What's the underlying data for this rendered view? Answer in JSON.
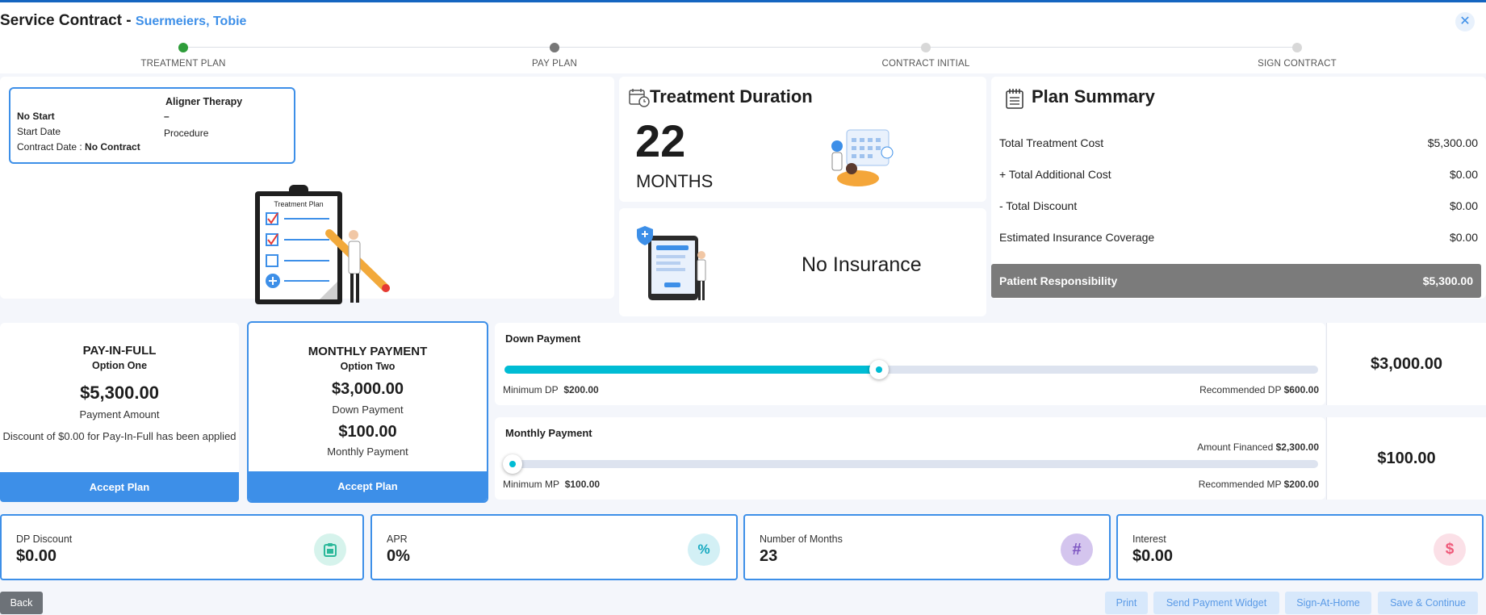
{
  "header": {
    "title": "Service Contract -",
    "patient_name": "Suermeiers, Tobie",
    "close_icon": "close-icon"
  },
  "stepper": {
    "steps": [
      {
        "label": "TREATMENT PLAN",
        "state": "done"
      },
      {
        "label": "PAY PLAN",
        "state": "current"
      },
      {
        "label": "CONTRACT INITIAL",
        "state": "pending"
      },
      {
        "label": "SIGN CONTRACT",
        "state": "pending"
      }
    ]
  },
  "treatment_plan": {
    "therapy": "Aligner Therapy",
    "no_start": "No Start",
    "dash": "–",
    "start_date_label": "Start Date",
    "procedure_label": "Procedure",
    "contract_date_label": "Contract Date :",
    "contract_date_value": "No Contract",
    "clipboard_title": "Treatment Plan"
  },
  "duration": {
    "title": "Treatment Duration",
    "months": "22",
    "months_label": "MONTHS"
  },
  "insurance": {
    "text": "No Insurance"
  },
  "summary": {
    "title": "Plan Summary",
    "rows": [
      {
        "label": "Total Treatment Cost",
        "value": "$5,300.00"
      },
      {
        "label": "+ Total Additional Cost",
        "value": "$0.00"
      },
      {
        "label": "- Total Discount",
        "value": "$0.00"
      },
      {
        "label": "Estimated Insurance Coverage",
        "value": "$0.00"
      }
    ],
    "total_label": "Patient Responsibility",
    "total_value": "$5,300.00"
  },
  "options": {
    "pay_in_full": {
      "title": "PAY-IN-FULL",
      "subtitle": "Option One",
      "amount": "$5,300.00",
      "amount_label": "Payment Amount",
      "note": "Discount of $0.00 for Pay-In-Full has been applied",
      "button": "Accept Plan"
    },
    "monthly": {
      "title": "MONTHLY PAYMENT",
      "subtitle": "Option Two",
      "down": "$3,000.00",
      "down_label": "Down Payment",
      "monthly": "$100.00",
      "monthly_label": "Monthly Payment",
      "button": "Accept Plan"
    }
  },
  "down_payment": {
    "title": "Down Payment",
    "min_label": "Minimum DP",
    "min_value": "$200.00",
    "rec_label": "Recommended DP",
    "rec_value": "$600.00",
    "value": "$3,000.00",
    "slider_fraction": 0.46
  },
  "monthly_payment": {
    "title": "Monthly Payment",
    "financed_label": "Amount Financed",
    "financed_value": "$2,300.00",
    "min_label": "Minimum MP",
    "min_value": "$100.00",
    "rec_label": "Recommended MP",
    "rec_value": "$200.00",
    "value": "$100.00",
    "slider_fraction": 0.01
  },
  "stats": [
    {
      "label": "DP Discount",
      "value": "$0.00",
      "icon": "clipboard-icon",
      "color": "#2bb89a",
      "bg": "#d6f3ec"
    },
    {
      "label": "APR",
      "value": "0%",
      "icon": "percent-icon",
      "color": "#16a9c0",
      "bg": "#d3f0f5"
    },
    {
      "label": "Number of Months",
      "value": "23",
      "icon": "hash-icon",
      "color": "#7e57c2",
      "bg": "#d4c5ee"
    },
    {
      "label": "Interest",
      "value": "$0.00",
      "icon": "dollar-icon",
      "color": "#ef5a7a",
      "bg": "#fbe0e7"
    }
  ],
  "footer": {
    "back": "Back",
    "print": "Print",
    "send_widget": "Send Payment Widget",
    "sign_home": "Sign-At-Home",
    "save_continue": "Save & Continue"
  },
  "colors": {
    "accent": "#3d8fe8",
    "slider": "#00bcd4",
    "total_bar": "#7b7b7b"
  }
}
